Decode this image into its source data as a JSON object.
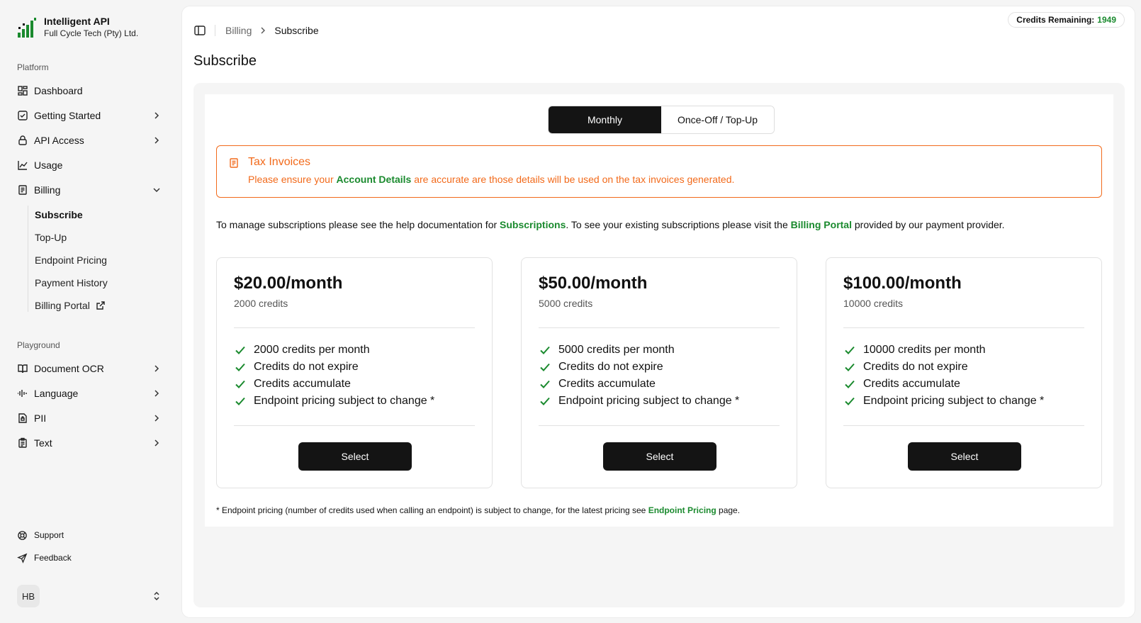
{
  "brand": {
    "name": "Intelligent API",
    "company": "Full Cycle Tech (Pty) Ltd.",
    "logo_color": "#1a8a2e"
  },
  "sidebar": {
    "platform_label": "Platform",
    "playground_label": "Playground",
    "platform_items": [
      {
        "label": "Dashboard",
        "icon": "dashboard-icon"
      },
      {
        "label": "Getting Started",
        "icon": "checkbox-icon",
        "expandable": true
      },
      {
        "label": "API Access",
        "icon": "lock-icon",
        "expandable": true
      },
      {
        "label": "Usage",
        "icon": "chart-icon"
      },
      {
        "label": "Billing",
        "icon": "receipt-icon",
        "expanded": true
      }
    ],
    "billing_sub": [
      {
        "label": "Subscribe",
        "active": true
      },
      {
        "label": "Top-Up"
      },
      {
        "label": "Endpoint Pricing"
      },
      {
        "label": "Payment History"
      },
      {
        "label": "Billing Portal",
        "icon": "external-link-icon"
      }
    ],
    "playground_items": [
      {
        "label": "Document OCR",
        "icon": "book-icon"
      },
      {
        "label": "Language",
        "icon": "audio-waveform-icon"
      },
      {
        "label": "PII",
        "icon": "file-lock-icon"
      },
      {
        "label": "Text",
        "icon": "clipboard-icon"
      }
    ],
    "support": "Support",
    "feedback": "Feedback",
    "user_initials": "HB"
  },
  "header": {
    "credits_label": "Credits Remaining:",
    "credits_value": "1949",
    "breadcrumb": [
      "Billing",
      "Subscribe"
    ],
    "page_title": "Subscribe"
  },
  "tabs": {
    "monthly": "Monthly",
    "once_off": "Once-Off / Top-Up",
    "selected": "Monthly"
  },
  "alert": {
    "title": "Tax Invoices",
    "msg_pre": "Please ensure your ",
    "msg_link": "Account Details",
    "msg_post": " are accurate are those details will be used on the tax invoices generated.",
    "color": "#f26a1b"
  },
  "manage": {
    "pre": "To manage subscriptions please see the help documentation for ",
    "link1": "Subscriptions",
    "mid": ". To see your existing subscriptions please visit the ",
    "link2": "Billing Portal",
    "post": " provided by our payment provider."
  },
  "plans": [
    {
      "price": "$20.00/month",
      "credits": "2000 credits",
      "features": [
        "2000 credits per month",
        "Credits do not expire",
        "Credits accumulate",
        "Endpoint pricing subject to change *"
      ],
      "button": "Select"
    },
    {
      "price": "$50.00/month",
      "credits": "5000 credits",
      "features": [
        "5000 credits per month",
        "Credits do not expire",
        "Credits accumulate",
        "Endpoint pricing subject to change *"
      ],
      "button": "Select"
    },
    {
      "price": "$100.00/month",
      "credits": "10000 credits",
      "features": [
        "10000 credits per month",
        "Credits do not expire",
        "Credits accumulate",
        "Endpoint pricing subject to change *"
      ],
      "button": "Select"
    }
  ],
  "footnote": {
    "pre": "* Endpoint pricing (number of credits used when calling an endpoint) is subject to change, for the latest pricing see ",
    "link": "Endpoint Pricing",
    "post": " page."
  },
  "colors": {
    "accent_green": "#1a8a2e",
    "warning_orange": "#f26a1b",
    "dark_button": "#141414"
  }
}
